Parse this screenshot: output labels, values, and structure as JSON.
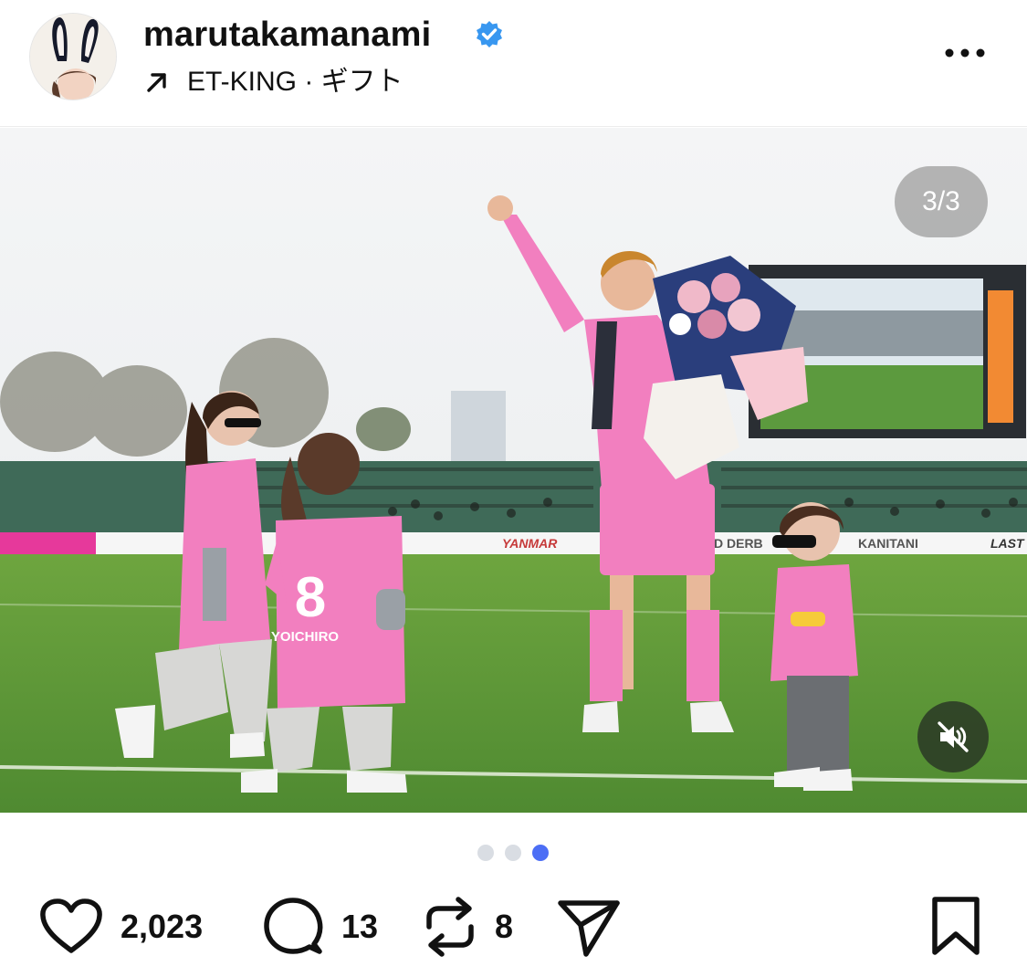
{
  "post": {
    "username": "marutakamanami",
    "audio_label": "ET-KING · ギフト",
    "slide_counter": "3/3",
    "slides": {
      "total": 3,
      "active": 3
    }
  },
  "photo": {
    "jersey_number": "8",
    "jersey_name": "YOICHIRO",
    "banner_texts": [
      "YANMAR",
      "D DERB",
      "KANITANI",
      "LAST"
    ]
  },
  "actions": {
    "likes": "2,023",
    "comments": "13",
    "reposts": "8"
  },
  "icons": {
    "verified": "verified-badge-icon",
    "audio": "arrow-up-right-icon",
    "more": "more-dots-icon",
    "mute": "speaker-muted-icon",
    "like": "heart-icon",
    "comment": "comment-bubble-icon",
    "repost": "repost-icon",
    "share": "send-icon",
    "save": "bookmark-icon"
  },
  "colors": {
    "accent": "#4c6ef5",
    "verified": "#3897f0",
    "jersey_pink": "#f27fbf",
    "pitch_green": "#5f9a3a"
  }
}
